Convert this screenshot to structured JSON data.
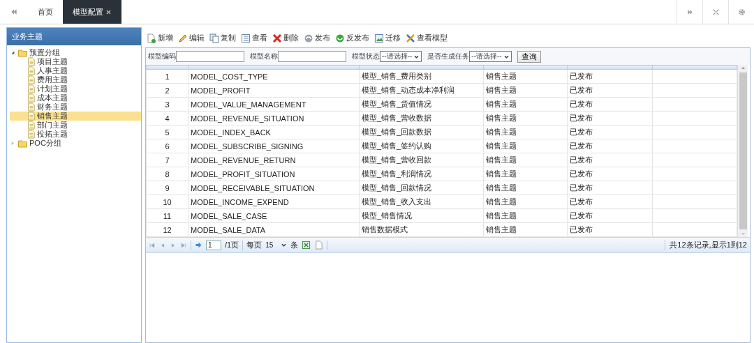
{
  "top_bar": {
    "tabs": [
      {
        "label": "首页",
        "selected": false,
        "closable": false
      },
      {
        "label": "模型配置",
        "selected": true,
        "closable": true
      }
    ]
  },
  "sidebar": {
    "title": "业务主题",
    "tree": [
      {
        "label": "预置分组",
        "expanded": true,
        "selected": false,
        "children": [
          {
            "label": "项目主题",
            "selected": false
          },
          {
            "label": "人事主题",
            "selected": false
          },
          {
            "label": "费用主题",
            "selected": false
          },
          {
            "label": "计划主题",
            "selected": false
          },
          {
            "label": "成本主题",
            "selected": false
          },
          {
            "label": "财务主题",
            "selected": false
          },
          {
            "label": "销售主题",
            "selected": true
          },
          {
            "label": "部门主题",
            "selected": false
          },
          {
            "label": "投拓主题",
            "selected": false
          }
        ]
      },
      {
        "label": "POC分组",
        "expanded": false,
        "selected": false
      }
    ]
  },
  "toolbar": [
    {
      "label": "新增",
      "kind": "new"
    },
    {
      "label": "编辑",
      "kind": "edit"
    },
    {
      "label": "复制",
      "kind": "copy"
    },
    {
      "label": "查看",
      "kind": "view"
    },
    {
      "label": "删除",
      "kind": "delete"
    },
    {
      "label": "发布",
      "kind": "publish"
    },
    {
      "label": "反发布",
      "kind": "unpublish"
    },
    {
      "label": "迁移",
      "kind": "migrate"
    },
    {
      "label": "查看模型",
      "kind": "tools"
    }
  ],
  "filters": [
    {
      "kind": "text",
      "label": "模型编码"
    },
    {
      "kind": "text",
      "label": "模型名称"
    },
    {
      "kind": "select",
      "label": "模型状态",
      "value": "--请选择--"
    },
    {
      "kind": "select",
      "label": "是否生成任务",
      "value": "--请选择--"
    }
  ],
  "search_button": "查询",
  "table": {
    "rows": [
      {
        "column_1": "1",
        "column_2": "MODEL_COST_TYPE",
        "column_3": "模型_销售_费用类别",
        "column_4": "销售主题",
        "column_5": "已发布"
      },
      {
        "column_1": "2",
        "column_2": "MODEL_PROFIT",
        "column_3": "模型_销售_动态成本净利润",
        "column_4": "销售主题",
        "column_5": "已发布"
      },
      {
        "column_1": "3",
        "column_2": "MODEL_VALUE_MANAGEMENT",
        "column_3": "模型_销售_货值情况",
        "column_4": "销售主题",
        "column_5": "已发布"
      },
      {
        "column_1": "4",
        "column_2": "MODEL_REVENUE_SITUATION",
        "column_3": "模型_销售_营收数据",
        "column_4": "销售主题",
        "column_5": "已发布"
      },
      {
        "column_1": "5",
        "column_2": "MODEL_INDEX_BACK",
        "column_3": "模型_销售_回款数据",
        "column_4": "销售主题",
        "column_5": "已发布"
      },
      {
        "column_1": "6",
        "column_2": "MODEL_SUBSCRIBE_SIGNING",
        "column_3": "模型_销售_签约认购",
        "column_4": "销售主题",
        "column_5": "已发布"
      },
      {
        "column_1": "7",
        "column_2": "MODEL_REVENUE_RETURN",
        "column_3": "模型_销售_营收回款",
        "column_4": "销售主题",
        "column_5": "已发布"
      },
      {
        "column_1": "8",
        "column_2": "MODEL_PROFIT_SITUATION",
        "column_3": "模型_销售_利润情况",
        "column_4": "销售主题",
        "column_5": "已发布"
      },
      {
        "column_1": "9",
        "column_2": "MODEL_RECEIVABLE_SITUATION",
        "column_3": "模型_销售_回款情况",
        "column_4": "销售主题",
        "column_5": "已发布"
      },
      {
        "column_1": "10",
        "column_2": "MODEL_INCOME_EXPEND",
        "column_3": "模型_销售_收入支出",
        "column_4": "销售主题",
        "column_5": "已发布"
      },
      {
        "column_1": "11",
        "column_2": "MODEL_SALE_CASE",
        "column_3": "模型_销售情况",
        "column_4": "销售主题",
        "column_5": "已发布"
      },
      {
        "column_1": "12",
        "column_2": "MODEL_SALE_DATA",
        "column_3": "销售数据模式",
        "column_4": "销售主题",
        "column_5": "已发布"
      }
    ]
  },
  "pager": {
    "page": "1",
    "page_total": "/1页",
    "per_page_label": "每页",
    "per_page": "15",
    "unit": "条",
    "summary": "共12条记录,显示1到12"
  }
}
